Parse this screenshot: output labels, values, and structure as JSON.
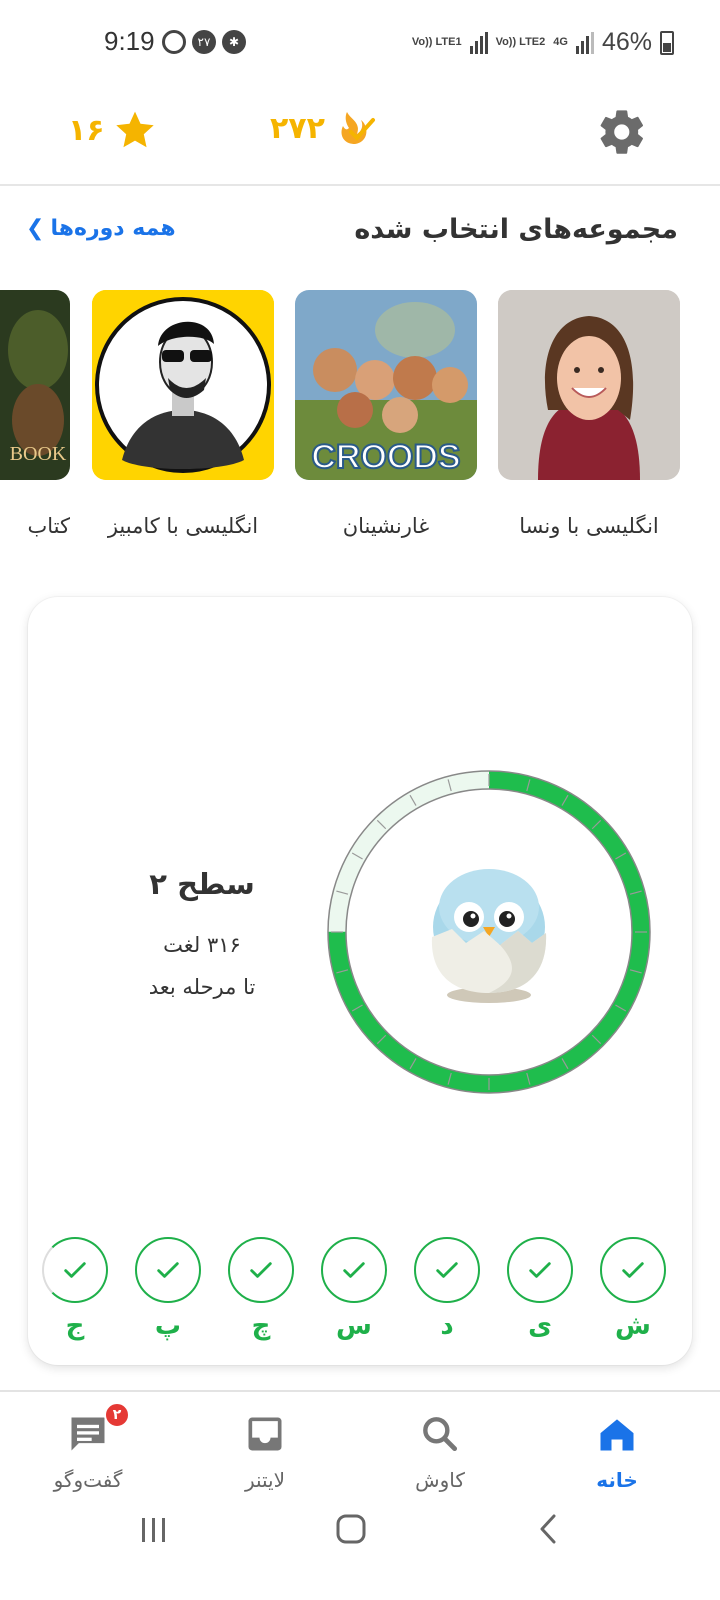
{
  "status_bar": {
    "time": "9:19",
    "notif_badge": "۲۷",
    "network1": "Vo)) LTE1",
    "network2": "Vo)) LTE2",
    "network_type": "4G",
    "battery": "46%"
  },
  "topbar": {
    "streak_value": "۲۷۲",
    "stars_value": "۱۶"
  },
  "section": {
    "title": "مجموعه‌های انتخاب شده",
    "all_courses": "همه دوره‌ها"
  },
  "courses": [
    {
      "label": "انگلیسی با ونسا"
    },
    {
      "label": "غارنشینان",
      "poster_text": "CROODS"
    },
    {
      "label": "انگلیسی با کامبیز"
    },
    {
      "label": "کتاب",
      "poster_text": "BOOK"
    }
  ],
  "level": {
    "title": "سطح ۲",
    "words": "۳۱۶ لغت",
    "next": "تا مرحله بعد",
    "progress": 0.75
  },
  "letters": [
    "ش",
    "ی",
    "د",
    "س",
    "چ",
    "پ",
    "ج"
  ],
  "bottom_nav": {
    "home": "خانه",
    "explore": "کاوش",
    "leitner": "لایتنر",
    "chat": "گفت‌وگو",
    "chat_badge": "۲"
  },
  "colors": {
    "accent": "#1a73e8",
    "gold": "#f5b400",
    "green": "#1fb04a"
  }
}
